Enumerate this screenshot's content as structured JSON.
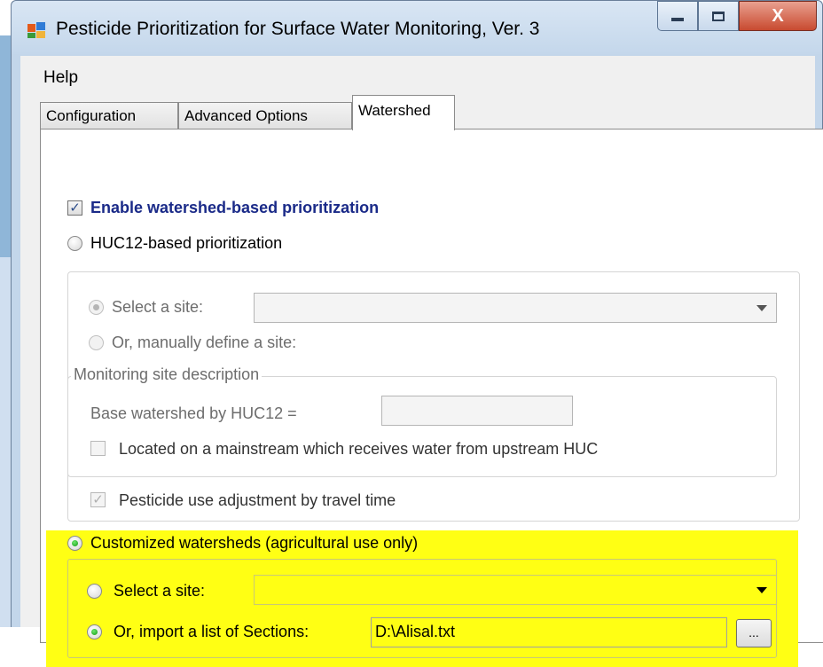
{
  "window": {
    "title": "Pesticide Prioritization for Surface Water Monitoring, Ver. 3",
    "close_glyph": "X"
  },
  "menu": {
    "help": "Help"
  },
  "tabs": [
    {
      "label": "Configuration",
      "active": false
    },
    {
      "label": "Advanced Options",
      "active": false
    },
    {
      "label": "Watershed",
      "active": true
    }
  ],
  "watershed": {
    "enable_label": "Enable watershed-based prioritization",
    "enable_checked": true,
    "huc12": {
      "label": "HUC12-based prioritization",
      "select_site_label": "Select a site:",
      "select_site_value": "",
      "manual_label": "Or, manually define a site:",
      "group_title": "Monitoring site description",
      "base_label": "Base watershed by HUC12 =",
      "base_value": "",
      "mainstream_label": "Located on a mainstream which receives water from upstream HUC",
      "mainstream_checked": false,
      "travel_label": "Pesticide use adjustment by travel time",
      "travel_checked": true
    },
    "custom": {
      "label": "Customized watersheds (agricultural use only)",
      "selected": true,
      "select_site_label": "Select a site:",
      "select_site_value": "",
      "import_label": "Or, import a list of Sections:",
      "import_selected": true,
      "import_value": "D:\\Alisal.txt",
      "browse_label": "..."
    }
  },
  "colors": {
    "highlight": "#ffff14",
    "radio_on": "#139a13",
    "bold_label": "#1a2a88"
  }
}
